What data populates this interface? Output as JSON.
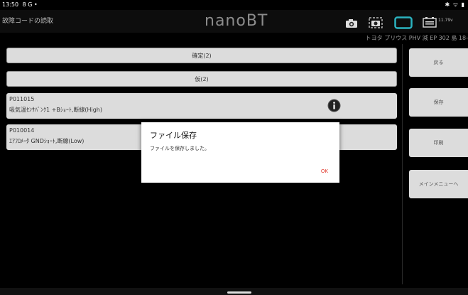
{
  "status_bar": {
    "time": "13:50",
    "left_icons": "8 G •",
    "right_icons": "✱ ᯤ ▮"
  },
  "app_bar": {
    "screen_title": "故障コードの読取",
    "app_title": "nanoBT",
    "voltage": "11.79v"
  },
  "vehicle_info": "トヨタ プリウス PHV 減 EP 302 島 18-",
  "main": {
    "confirmed_label": "確定(2)",
    "pending_label": "仮(2)",
    "dtc_rows": [
      {
        "code": "P011015",
        "description": "吸気温ｾﾝｻﾊﾞﾝｸ1 +Bｼｮｰﾄ,断線(High)"
      },
      {
        "code": "P010014",
        "description": "ｴｱﾌﾛﾒｰﾀ GNDｼｮｰﾄ,断線(Low)"
      }
    ]
  },
  "sidebar": {
    "back": "戻る",
    "save": "保存",
    "print": "印刷",
    "main_menu": "メインメニューへ"
  },
  "dialog": {
    "title": "ファイル保存",
    "message": "ファイルを保存しました。",
    "ok": "OK"
  }
}
